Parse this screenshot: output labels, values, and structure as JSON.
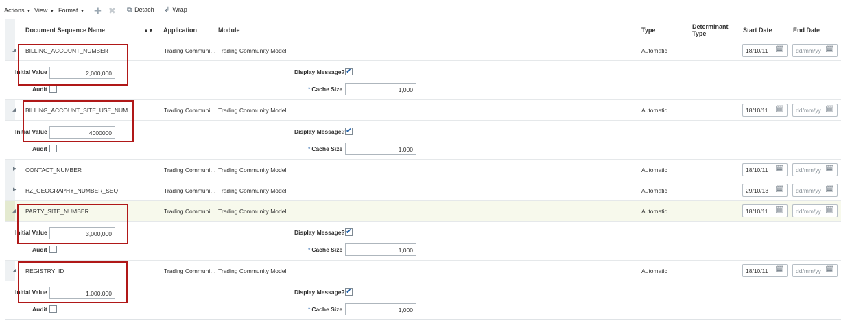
{
  "toolbar": {
    "actions": "Actions",
    "view": "View",
    "format": "Format",
    "add_icon": "plus-icon",
    "delete_icon": "x-icon",
    "detach": "Detach",
    "wrap": "Wrap"
  },
  "columns": {
    "name": "Document Sequence Name",
    "application": "Application",
    "module": "Module",
    "type": "Type",
    "det_type_1": "Determinant",
    "det_type_2": "Type",
    "start_date": "Start Date",
    "end_date": "End Date"
  },
  "labels": {
    "initial_value": "Initial Value",
    "audit": "Audit",
    "display_message": "Display Message?",
    "cache_size": "Cache Size",
    "required": "*"
  },
  "rows": [
    {
      "name": "BILLING_ACCOUNT_NUMBER",
      "application": "Trading Communi…",
      "module": "Trading Community Model",
      "type": "Automatic",
      "start": "18/10/11",
      "end": "dd/mm/yy",
      "expanded": true,
      "initial_value": "2,000,000",
      "cache_size": "1,000",
      "display_message": true,
      "audit": false
    },
    {
      "name": "BILLING_ACCOUNT_SITE_USE_NUM",
      "application": "Trading Communi…",
      "module": "Trading Community Model",
      "type": "Automatic",
      "start": "18/10/11",
      "end": "dd/mm/yy",
      "expanded": true,
      "initial_value": "4000000",
      "cache_size": "1,000",
      "display_message": true,
      "audit": false
    },
    {
      "name": "CONTACT_NUMBER",
      "application": "Trading Communi…",
      "module": "Trading Community Model",
      "type": "Automatic",
      "start": "18/10/11",
      "end": "dd/mm/yy",
      "expanded": false
    },
    {
      "name": "HZ_GEOGRAPHY_NUMBER_SEQ",
      "application": "Trading Communi…",
      "module": "Trading Community Model",
      "type": "Automatic",
      "start": "29/10/13",
      "end": "dd/mm/yy",
      "expanded": false
    },
    {
      "name": "PARTY_SITE_NUMBER",
      "application": "Trading Communi…",
      "module": "Trading Community Model",
      "type": "Automatic",
      "start": "18/10/11",
      "end": "dd/mm/yy",
      "expanded": true,
      "selected": true,
      "initial_value": "3,000,000",
      "cache_size": "1,000",
      "display_message": true,
      "audit": false
    },
    {
      "name": "REGISTRY_ID",
      "application": "Trading Communi…",
      "module": "Trading Community Model",
      "type": "Automatic",
      "start": "18/10/11",
      "end": "dd/mm/yy",
      "expanded": true,
      "initial_value": "1,000,000",
      "cache_size": "1,000",
      "display_message": true,
      "audit": false
    }
  ],
  "colors": {
    "highlight": "#b01818",
    "checkmark": "#1f5fa8",
    "selected_row": "#f7f9ec"
  }
}
